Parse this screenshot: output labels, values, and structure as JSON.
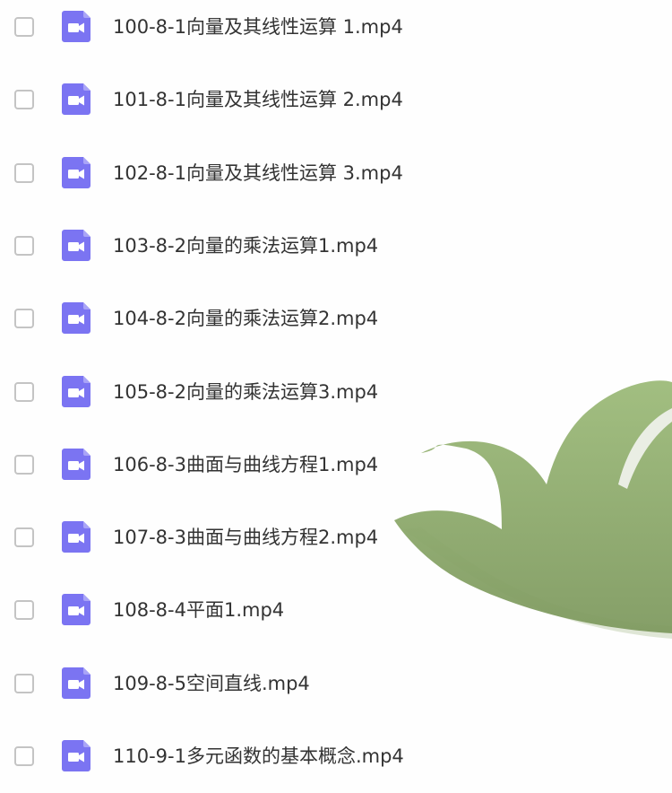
{
  "colors": {
    "icon_fill": "#7b74f2",
    "checkbox_border": "#c4c4c4",
    "text": "#333333",
    "watermark_leaf": "#8fae6c"
  },
  "icon_type": "video-file-icon",
  "files": [
    {
      "name": "100-8-1向量及其线性运算 1.mp4"
    },
    {
      "name": "101-8-1向量及其线性运算 2.mp4"
    },
    {
      "name": "102-8-1向量及其线性运算 3.mp4"
    },
    {
      "name": "103-8-2向量的乘法运算1.mp4"
    },
    {
      "name": "104-8-2向量的乘法运算2.mp4"
    },
    {
      "name": "105-8-2向量的乘法运算3.mp4"
    },
    {
      "name": "106-8-3曲面与曲线方程1.mp4"
    },
    {
      "name": "107-8-3曲面与曲线方程2.mp4"
    },
    {
      "name": "108-8-4平面1.mp4"
    },
    {
      "name": "109-8-5空间直线.mp4"
    },
    {
      "name": "110-9-1多元函数的基本概念.mp4"
    }
  ]
}
